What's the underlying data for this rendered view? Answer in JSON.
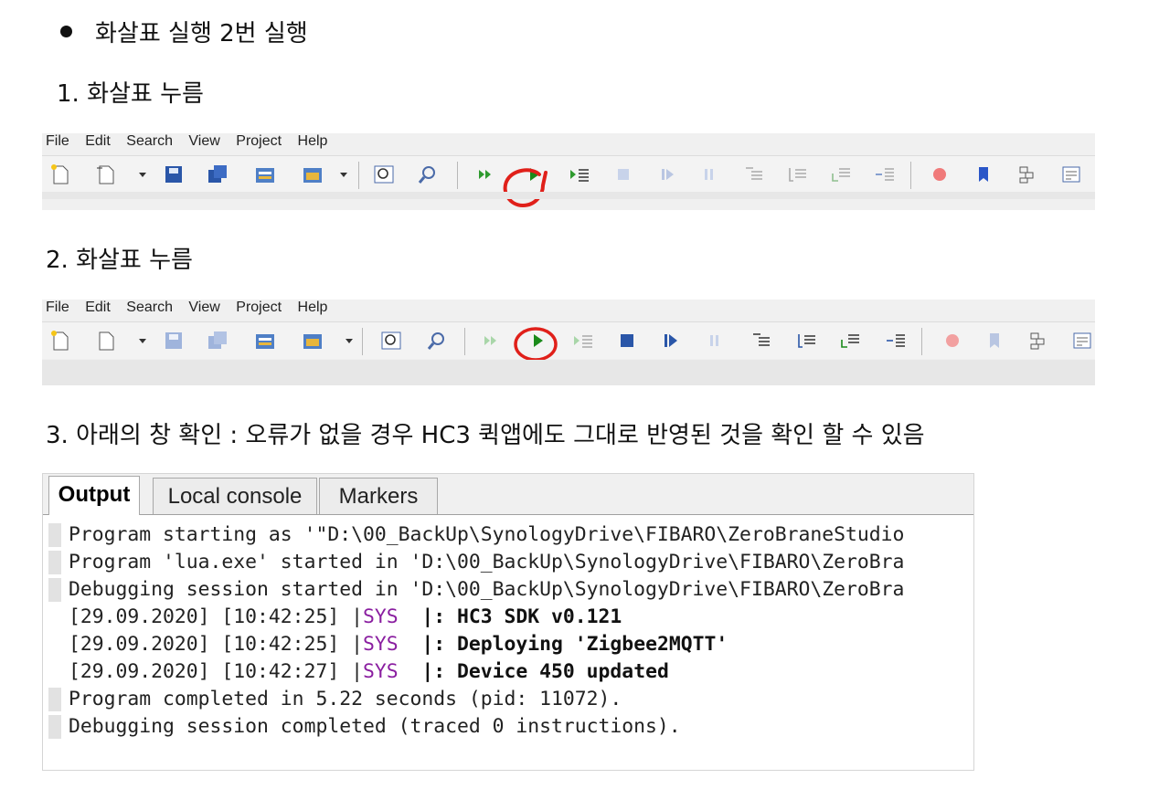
{
  "steps": {
    "bullet_text": "화살표 실행 2번 실행",
    "step1": "1.  화살표 누름",
    "step2": "2. 화살표 누름",
    "step3": "3. 아래의 창 확인 : 오류가 없을 경우 HC3 퀵앱에도 그대로 반영된 것을 확인 할 수 있음"
  },
  "menu": [
    "File",
    "Edit",
    "Search",
    "View",
    "Project",
    "Help"
  ],
  "toolbar_icons": [
    "new-file-icon",
    "open-file-icon",
    "save-icon",
    "save-all-icon",
    "project-folder-icon",
    "project-open-icon",
    "find-icon",
    "find-in-files-icon",
    "run-fast-icon",
    "run-icon",
    "step-icon",
    "stop-icon",
    "step-over-icon",
    "pause-icon",
    "step-into-icon",
    "step-out-icon",
    "run-to-cursor-icon",
    "toggle-indent-icon",
    "breakpoint-icon",
    "bookmark-icon",
    "toggle-icon",
    "console-icon"
  ],
  "output": {
    "tabs": [
      "Output",
      "Local console",
      "Markers"
    ],
    "lines": [
      {
        "text": "Program starting as '\"D:\\00_BackUp\\SynologyDrive\\FIBARO\\ZeroBraneStudio",
        "marked": true
      },
      {
        "text": "Program 'lua.exe' started in 'D:\\00_BackUp\\SynologyDrive\\FIBARO\\ZeroBra",
        "marked": true
      },
      {
        "text": "Debugging session started in 'D:\\00_BackUp\\SynologyDrive\\FIBARO\\ZeroBra",
        "marked": true
      }
    ],
    "log": [
      {
        "prefix": "[29.09.2020] [10:42:25] |",
        "tag": "SYS",
        "sep": "  |: ",
        "msg": "HC3 SDK v0.121"
      },
      {
        "prefix": "[29.09.2020] [10:42:25] |",
        "tag": "SYS",
        "sep": "  |: ",
        "msg": "Deploying 'Zigbee2MQTT'"
      },
      {
        "prefix": "[29.09.2020] [10:42:27] |",
        "tag": "SYS",
        "sep": "  |: ",
        "msg": "Device 450 updated"
      }
    ],
    "tail": [
      {
        "text": "Program completed in 5.22 seconds (pid: 11072).",
        "marked": true
      },
      {
        "text": "Debugging session completed (traced 0 instructions).",
        "marked": true
      }
    ]
  },
  "colors": {
    "sys": "#8a1ea0",
    "highlight": "#e0201a",
    "run": "#1a8a1a"
  }
}
